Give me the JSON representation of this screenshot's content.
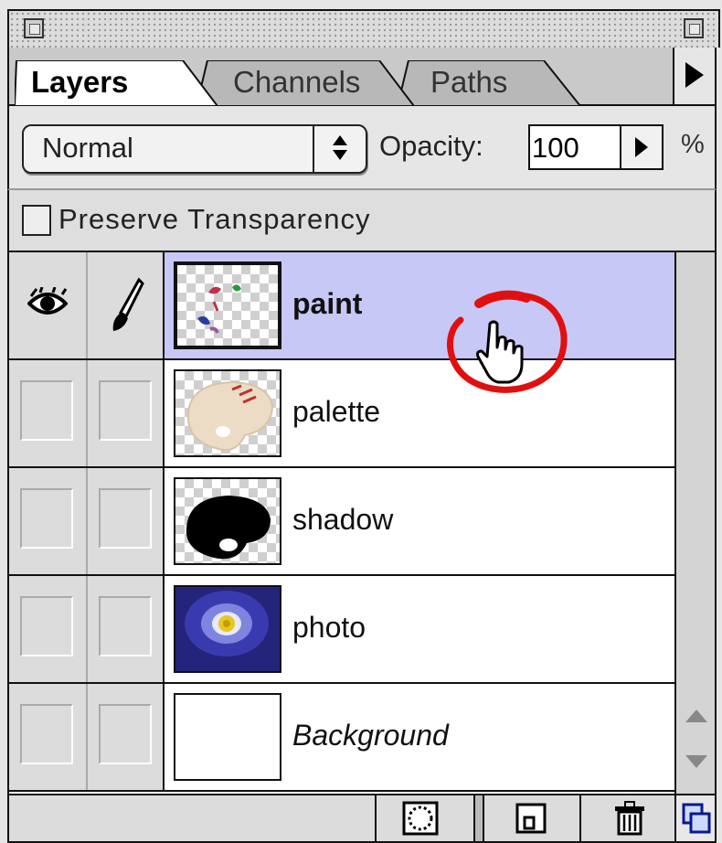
{
  "panel": {
    "tabs": [
      {
        "label": "Layers",
        "active": true
      },
      {
        "label": "Channels",
        "active": false
      },
      {
        "label": "Paths",
        "active": false
      }
    ],
    "blend_mode": "Normal",
    "opacity_label": "Opacity:",
    "opacity_value": "100",
    "percent_sign": "%",
    "preserve_transparency_label": "Preserve Transparency",
    "preserve_transparency_checked": false
  },
  "layers": [
    {
      "name": "paint",
      "selected": true,
      "visible": true,
      "brush": true,
      "thumbnail": "paint-splatter"
    },
    {
      "name": "palette",
      "selected": false,
      "visible": false,
      "brush": false,
      "thumbnail": "palette"
    },
    {
      "name": "shadow",
      "selected": false,
      "visible": false,
      "brush": false,
      "thumbnail": "shadow"
    },
    {
      "name": "photo",
      "selected": false,
      "visible": false,
      "brush": false,
      "thumbnail": "flower-photo"
    },
    {
      "name": "Background",
      "selected": false,
      "visible": false,
      "brush": false,
      "thumbnail": "blank",
      "italic": true
    }
  ],
  "toolbar_icons": [
    "mask-icon",
    "new-layer-icon",
    "trash-icon",
    "resize-icon"
  ],
  "colors": {
    "selected_row": "#c7c8f5",
    "panel_bg": "#e6e6e6",
    "annotation_circle": "#e01010"
  }
}
